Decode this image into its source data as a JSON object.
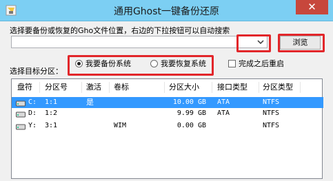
{
  "window": {
    "title": "通用Ghost一键备份还原",
    "close_glyph": "✕"
  },
  "path_section": {
    "label": "选择要备份或恢复的Gho文件位置，右边的下拉按钮可以自动搜索",
    "input_value": "",
    "browse_label": "浏览"
  },
  "target_section": {
    "label": "选择目标分区：",
    "radio_backup": {
      "label": "我要备份系统",
      "checked": true
    },
    "radio_restore": {
      "label": "我要恢复系统",
      "checked": false
    },
    "reboot_checkbox": {
      "label": "完成之后重启",
      "checked": false
    }
  },
  "table": {
    "headers": [
      "盘符",
      "分区号",
      "激活",
      "卷标",
      "分区大小",
      "接口类型",
      "分区类型"
    ],
    "rows": [
      {
        "drive": "C:",
        "partition": "1:1",
        "active": "是",
        "label": "",
        "size": "10.00 GB",
        "interface": "ATA",
        "fs": "NTFS",
        "selected": true
      },
      {
        "drive": "D:",
        "partition": "1:2",
        "active": "",
        "label": "",
        "size": "9.99 GB",
        "interface": "ATA",
        "fs": "NTFS",
        "selected": false
      },
      {
        "drive": "Y:",
        "partition": "3:1",
        "active": "",
        "label": "WIM",
        "size": "0.00 GB",
        "interface": "",
        "fs": "NTFS",
        "selected": false
      }
    ]
  },
  "colors": {
    "titlebar": "#7ccff3",
    "highlight": "#e2262a",
    "selection": "#3399ff",
    "close": "#c7473c"
  },
  "icons": [
    "app-icon",
    "close-icon",
    "dropdown-arrow-icon",
    "drive-icon"
  ]
}
